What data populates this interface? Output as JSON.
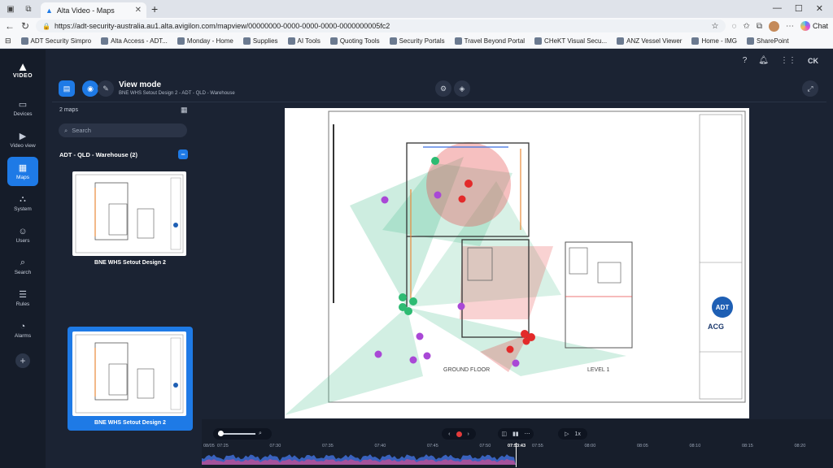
{
  "browser": {
    "tab_title": "Alta Video - Maps",
    "url": "https://adt-security-australia.au1.alta.avigilon.com/mapview/00000000-0000-0000-0000-0000000005fc2",
    "bookmarks": [
      "ADT Security Simpro",
      "Alta Access - ADT...",
      "Monday - Home",
      "Supplies",
      "AI Tools",
      "Quoting Tools",
      "Security Portals",
      "Travel Beyond Portal",
      "CHeKT Visual Secu...",
      "ANZ Vessel Viewer",
      "Home - IMG",
      "SharePoint"
    ],
    "chat_label": "Chat"
  },
  "app": {
    "brand": "VIDEO",
    "rail": [
      {
        "label": "Devices",
        "icon": "devices-icon"
      },
      {
        "label": "Video view",
        "icon": "video-view-icon"
      },
      {
        "label": "Maps",
        "icon": "maps-icon",
        "active": true
      },
      {
        "label": "System",
        "icon": "system-icon"
      },
      {
        "label": "Users",
        "icon": "users-icon"
      },
      {
        "label": "Search",
        "icon": "search-icon"
      },
      {
        "label": "Rules",
        "icon": "rules-icon"
      },
      {
        "label": "Alarms",
        "icon": "alarms-icon"
      }
    ],
    "user_initials": "CK"
  },
  "header": {
    "title": "View mode",
    "breadcrumb": "BNE WHS Setout Design 2 - ADT - QLD - Warehouse"
  },
  "sidebar": {
    "count": "2 maps",
    "search_placeholder": "Search",
    "group": "ADT - QLD - Warehouse (2)",
    "maps": [
      {
        "name": "BNE WHS Setout Design 2",
        "selected": false
      },
      {
        "name": "BNE WHS Setout Design 2",
        "selected": true
      }
    ]
  },
  "floorplan": {
    "ground_label": "GROUND FLOOR",
    "level_label": "LEVEL 1",
    "logo_text": "ADT",
    "acg_text": "ACG"
  },
  "timeline": {
    "speed": "1x",
    "current_time": "07:53:43",
    "date_label": "08/05",
    "ticks": [
      "07:25",
      "07:30",
      "07:35",
      "07:40",
      "07:45",
      "07:50",
      "07:55",
      "08:00",
      "08:05",
      "08:10",
      "08:15",
      "08:20"
    ],
    "colors": {
      "accent": "#1e7ae6",
      "wave_blue": "#3f6fd8",
      "wave_pink": "#d04b8c"
    }
  }
}
